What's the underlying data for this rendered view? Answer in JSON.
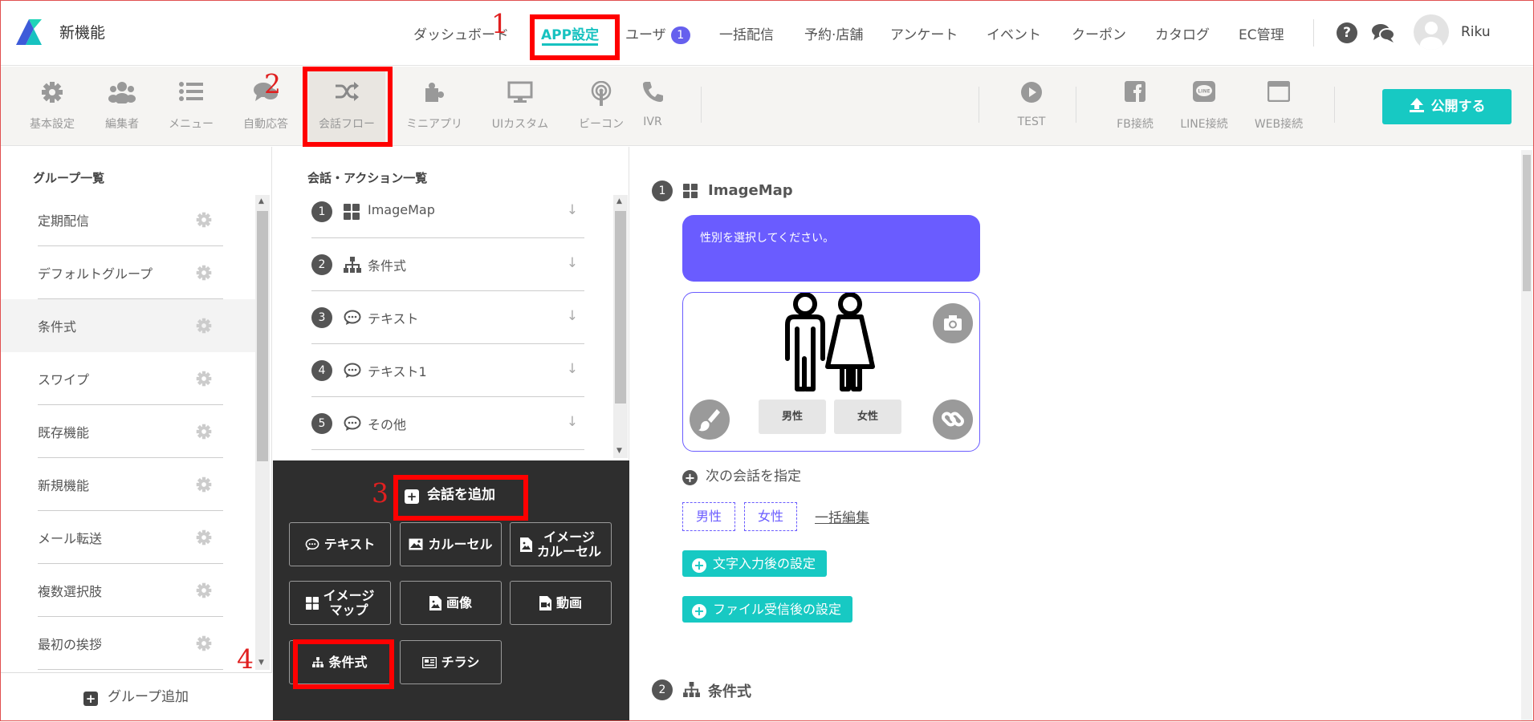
{
  "app": {
    "brand": "新機能",
    "username": "Riku"
  },
  "topnav": {
    "items": [
      {
        "label": "ダッシュボード",
        "active": false
      },
      {
        "label": "APP設定",
        "active": true
      },
      {
        "label": "ユーザ",
        "badge": "1",
        "active": false
      },
      {
        "label": "一括配信",
        "active": false
      },
      {
        "label": "予約·店舗",
        "active": false
      },
      {
        "label": "アンケート",
        "active": false
      },
      {
        "label": "イベント",
        "active": false
      },
      {
        "label": "クーポン",
        "active": false
      },
      {
        "label": "カタログ",
        "active": false
      },
      {
        "label": "EC管理",
        "active": false
      }
    ],
    "help_icon": "question-circle-icon",
    "chat_icon": "chat-bubbles-icon"
  },
  "toolbar": {
    "items": [
      {
        "label": "基本設定",
        "icon": "gear-icon"
      },
      {
        "label": "編集者",
        "icon": "users-icon"
      },
      {
        "label": "メニュー",
        "icon": "list-icon"
      },
      {
        "label": "自動応答",
        "icon": "chat-icon"
      },
      {
        "label": "会話フロー",
        "icon": "shuffle-icon",
        "active": true
      },
      {
        "label": "ミニアプリ",
        "icon": "puzzle-icon"
      },
      {
        "label": "UIカスタム",
        "icon": "monitor-icon"
      },
      {
        "label": "ビーコン",
        "icon": "beacon-icon"
      },
      {
        "label": "IVR",
        "icon": "phone-icon"
      },
      {
        "label": "TEST",
        "icon": "play-icon"
      },
      {
        "label": "FB接続",
        "icon": "facebook-icon"
      },
      {
        "label": "LINE接続",
        "icon": "line-icon"
      },
      {
        "label": "WEB接続",
        "icon": "browser-icon"
      }
    ],
    "publish_label": "公開する"
  },
  "groups": {
    "title": "グループ一覧",
    "items": [
      "定期配信",
      "デフォルトグループ",
      "条件式",
      "スワイプ",
      "既存機能",
      "新規機能",
      "メール転送",
      "複数選択肢",
      "最初の挨拶"
    ],
    "selected": "条件式",
    "add_label": "グループ追加"
  },
  "conversations": {
    "title": "会話・アクション一覧",
    "items": [
      {
        "num": "1",
        "label": "ImageMap",
        "icon": "grid-icon"
      },
      {
        "num": "2",
        "label": "条件式",
        "icon": "sitemap-icon"
      },
      {
        "num": "3",
        "label": "テキスト",
        "icon": "speech-bubble-icon"
      },
      {
        "num": "4",
        "label": "テキスト1",
        "icon": "speech-bubble-icon"
      },
      {
        "num": "5",
        "label": "その他",
        "icon": "speech-bubble-icon"
      }
    ],
    "add_label": "会話を追加",
    "actions": [
      {
        "label": "テキスト",
        "icon": "speech-bubble-icon"
      },
      {
        "label": "カルーセル",
        "icon": "image-icon"
      },
      {
        "label": "イメージ\nカルーセル",
        "icon": "image-file-icon"
      },
      {
        "label": "イメージ\nマップ",
        "icon": "grid-icon"
      },
      {
        "label": "画像",
        "icon": "image-file-icon"
      },
      {
        "label": "動画",
        "icon": "video-file-icon"
      },
      {
        "label": "条件式",
        "icon": "sitemap-icon"
      },
      {
        "label": "チラシ",
        "icon": "newspaper-icon"
      }
    ]
  },
  "detail": {
    "step1": {
      "num": "1",
      "title": "ImageMap",
      "message": "性別を選択してください。",
      "options": [
        "男性",
        "女性"
      ]
    },
    "next_conv_label": "次の会話を指定",
    "tags": [
      "男性",
      "女性"
    ],
    "bulk_edit": "一括編集",
    "after_text_input": "文字入力後の設定",
    "after_file_receive": "ファイル受信後の設定",
    "step2": {
      "num": "2",
      "title": "条件式"
    }
  },
  "annotations": [
    "1",
    "2",
    "3",
    "4"
  ],
  "colors": {
    "accent": "#17c2c0",
    "purple": "#6a5cff",
    "badge": "#6660ee",
    "dark_panel": "#2e2e2e",
    "highlight": "#ff0000"
  }
}
